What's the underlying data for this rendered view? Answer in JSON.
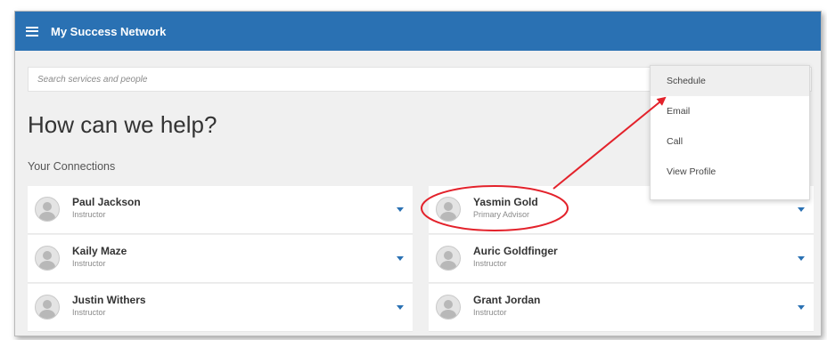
{
  "header": {
    "title": "My Success Network",
    "menu_icon": "hamburger-menu-icon"
  },
  "search": {
    "placeholder": "Search services and people"
  },
  "main": {
    "title": "How can we help?",
    "section_title": "Your Connections"
  },
  "connections": [
    {
      "name": "Paul Jackson",
      "role": "Instructor"
    },
    {
      "name": "Yasmin Gold",
      "role": "Primary Advisor"
    },
    {
      "name": "Kaily Maze",
      "role": "Instructor"
    },
    {
      "name": "Auric Goldfinger",
      "role": "Instructor"
    },
    {
      "name": "Justin Withers",
      "role": "Instructor"
    },
    {
      "name": "Grant Jordan",
      "role": "Instructor"
    }
  ],
  "dropdown": {
    "items": [
      {
        "label": "Schedule"
      },
      {
        "label": "Email"
      },
      {
        "label": "Call"
      },
      {
        "label": "View Profile"
      }
    ]
  },
  "colors": {
    "header_bg": "#2a71b3",
    "annotation": "#e3222b",
    "accent": "#2a71b3"
  }
}
